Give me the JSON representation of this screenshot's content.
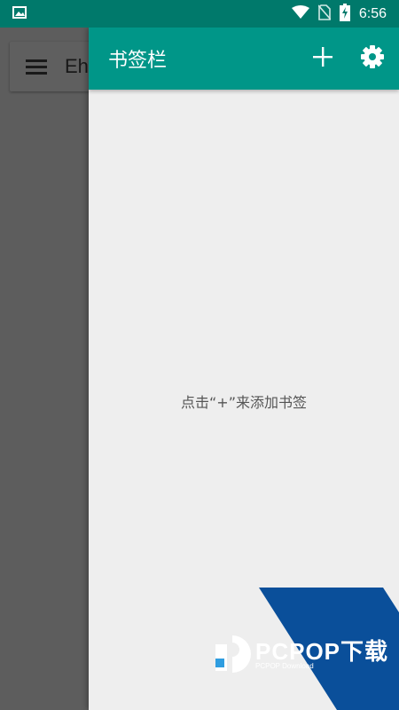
{
  "status_bar": {
    "time": "6:56",
    "icons": [
      "image-notification-icon",
      "wifi-icon",
      "no-sim-icon",
      "battery-charging-icon"
    ]
  },
  "background_app": {
    "title": "Eh"
  },
  "drawer": {
    "title": "书签栏",
    "add_icon": "plus-icon",
    "settings_icon": "gear-icon",
    "empty_hint": "点击“+”来添加书签"
  },
  "watermark": {
    "brand": "PCPOP下载",
    "subtitle": "PCPOP Download"
  },
  "colors": {
    "status_bar": "#00796b",
    "toolbar": "#009688",
    "drawer_bg": "#eeeeee",
    "watermark_blue": "#0a4f9a"
  }
}
